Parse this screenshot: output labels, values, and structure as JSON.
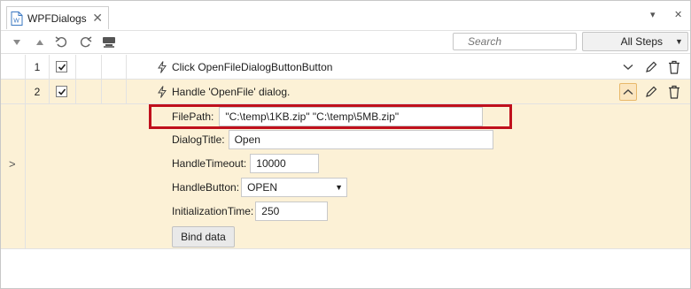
{
  "tab": {
    "title": "WPFDialogs",
    "close_glyph": "✕"
  },
  "tabbar": {
    "dropdown_glyph": "▾",
    "close_glyph": "✕"
  },
  "toolbar": {
    "search_placeholder": "Search",
    "steps_filter": "All Steps",
    "icons": [
      "move-down-icon",
      "move-up-icon",
      "undo-icon",
      "redo-icon",
      "record-icon"
    ]
  },
  "steps": [
    {
      "number": "1",
      "checked": true,
      "label": "Click OpenFileDialogButtonButton"
    },
    {
      "number": "2",
      "checked": true,
      "label": "Handle 'OpenFile' dialog."
    }
  ],
  "details": {
    "expander_glyph": ">",
    "filepath": {
      "label": "FilePath:",
      "value": "\"C:\\temp\\1KB.zip\" \"C:\\temp\\5MB.zip\""
    },
    "dialogtitle": {
      "label": "DialogTitle:",
      "value": "Open"
    },
    "handletimeout": {
      "label": "HandleTimeout:",
      "value": "10000"
    },
    "handlebutton": {
      "label": "HandleButton:",
      "value": "OPEN"
    },
    "initializationtime": {
      "label": "InitializationTime:",
      "value": "250"
    },
    "bind_button": "Bind data"
  },
  "colors": {
    "selected_row": "#fcf1d6",
    "highlight_box": "#c0101c",
    "accent": "#e8b86a"
  }
}
